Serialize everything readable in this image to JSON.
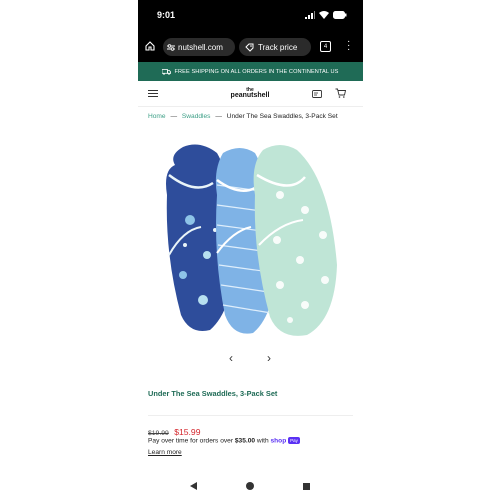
{
  "status": {
    "time": "9:01"
  },
  "browser": {
    "url": "nutshell.com",
    "track_price": "Track price",
    "tab_count": "4"
  },
  "promo": {
    "text": "FREE SHIPPING ON ALL ORDERS IN THE CONTINENTAL US"
  },
  "site": {
    "logo_top": "the",
    "logo_bottom": "peanutshell"
  },
  "breadcrumb": {
    "items": [
      "Home",
      "Swaddles",
      "Under The Sea Swaddles, 3-Pack Set"
    ],
    "separator": "—"
  },
  "carousel": {
    "prev": "‹",
    "next": "›"
  },
  "product": {
    "title": "Under The Sea Swaddles, 3-Pack Set",
    "price_original": "$19.99",
    "price_sale": "$15.99",
    "pay_text_prefix": "Pay over time for orders over",
    "pay_amount": "$35.00",
    "pay_text_with": "with",
    "pay_brand": "shop",
    "pay_badge": "Pay",
    "learn_more": "Learn more"
  },
  "colors": {
    "brand_green": "#1f6b56",
    "link_green": "#3c9f86",
    "sale_red": "#d4262c",
    "shop_purple": "#5a31f4"
  }
}
